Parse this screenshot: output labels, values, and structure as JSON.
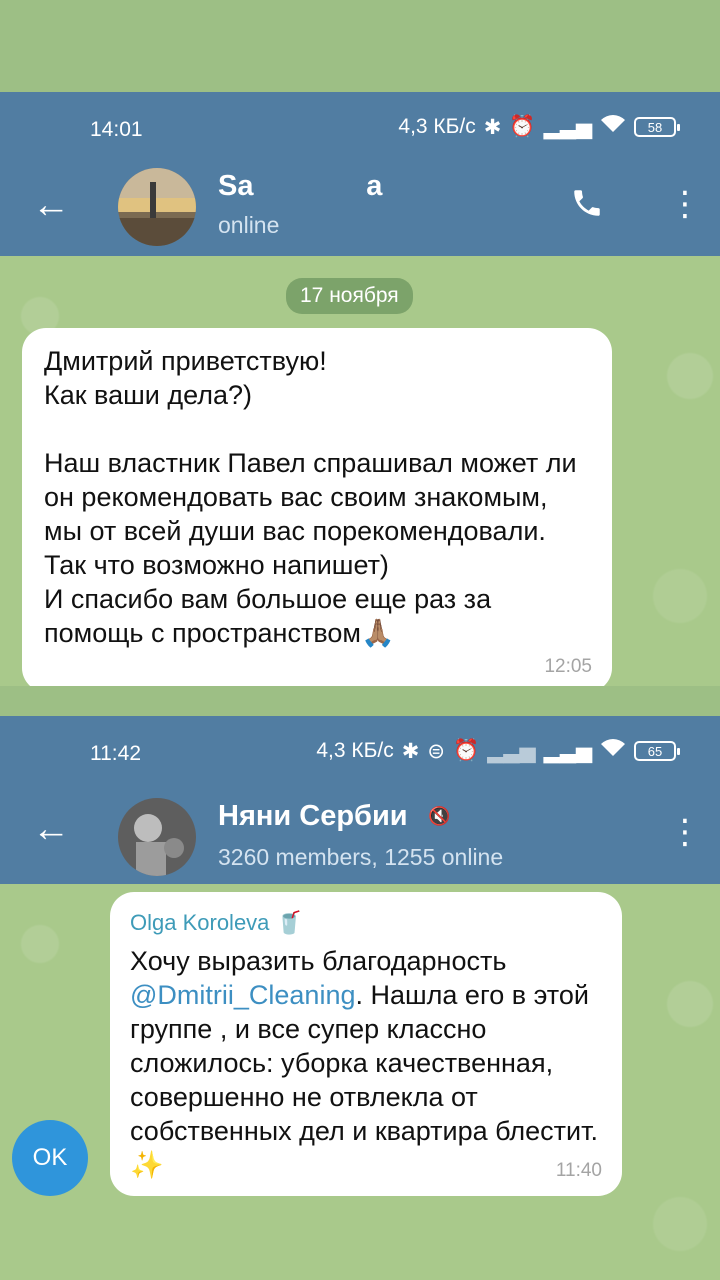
{
  "screen1": {
    "status": {
      "time": "14:01",
      "speed": "4,3 КБ/с",
      "bluetooth": "bluetooth-icon",
      "alarm": "alarm-icon",
      "signal": "signal-icon",
      "wifi": "wifi-icon",
      "battery": "58"
    },
    "header": {
      "name": "Sa              a",
      "status": "online"
    },
    "date": "17 ноября",
    "message": {
      "text": "Дмитрий приветствую!\nКак ваши дела?)\n\nНаш властник Павел спрашивал может ли он рекомендовать вас своим знакомым, мы от всей души вас порекомендовали.\nТак что возможно напишет)\nИ спасибо вам большое еще раз за помощь с пространством🙏🏽",
      "time": "12:05"
    }
  },
  "screen2": {
    "status": {
      "time": "11:42",
      "speed": "4,3 КБ/с",
      "battery": "65"
    },
    "header": {
      "name": "Няни Сербии",
      "members": "3260 members, 1255 online"
    },
    "message": {
      "sender": "Olga Koroleva",
      "text_before": "Хочу выразить благодарность ",
      "mention": "@Dmitrii_Cleaning",
      "text_after": ". Нашла его в этой группе , и все супер классно сложилось: уборка качественная, совершенно не отвлекла от собственных дел и квартира блестит. ✨",
      "time": "11:40"
    },
    "ok_label": "OK"
  }
}
